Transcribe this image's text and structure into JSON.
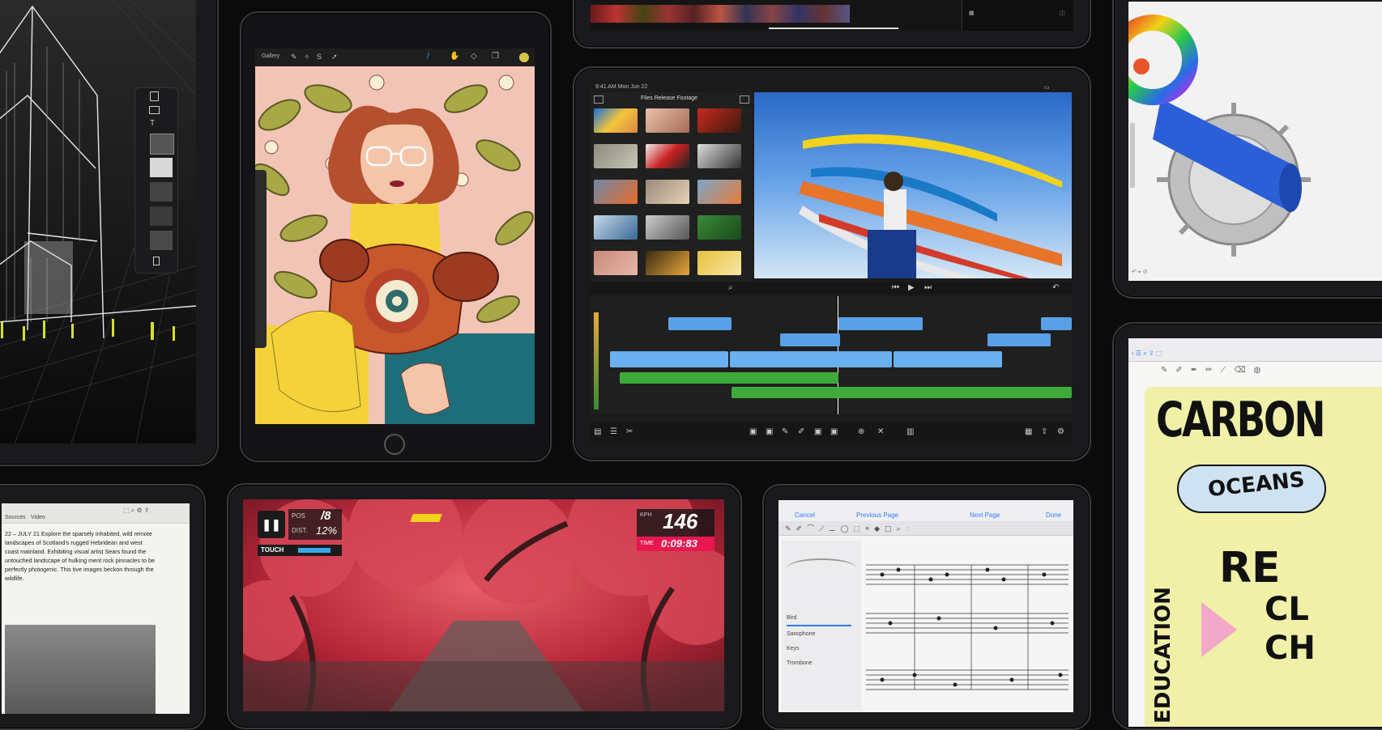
{
  "procreate": {
    "gallery": "Gallery"
  },
  "lumafusion": {
    "status_time": "9:41 AM  Mon Jun 22",
    "library_title": "Files Release Footage",
    "accent": "#2f7cf6"
  },
  "game": {
    "pos_label": "POS",
    "pos_value": "/8",
    "dist_label": "DIST.",
    "dist_value": "12%",
    "touch_label": "TOUCH",
    "speed_label": "KPH",
    "speed_value": "146",
    "time_label": "TIME",
    "time_value": "0:09:83",
    "accent": "#e8174f"
  },
  "reader": {
    "tab_1": "Sources",
    "tab_2": "Video",
    "body": "22 – JULY 21   Explore the sparsely inhabited, wild remote landscapes of Scotland’s rugged Hebridean and west coast mainland. Exhibiting visual artist Sears found the untouched landscape of hulking ment rock pinnacles to be perfectly photogenic. This tive images beckon through the wildlife."
  },
  "score": {
    "cancel": "Cancel",
    "previous": "Previous Page",
    "next": "Next Page",
    "done": "Done",
    "row_1": "Bird",
    "row_2": "Saxophone",
    "row_3": "Keys",
    "row_4": "Trombone"
  },
  "notes": {
    "word_1": "CARBON",
    "word_2": "OCEANS",
    "word_3": "RE",
    "word_4": "CL",
    "word_5": "CH",
    "vertical": "EDUCATION"
  }
}
